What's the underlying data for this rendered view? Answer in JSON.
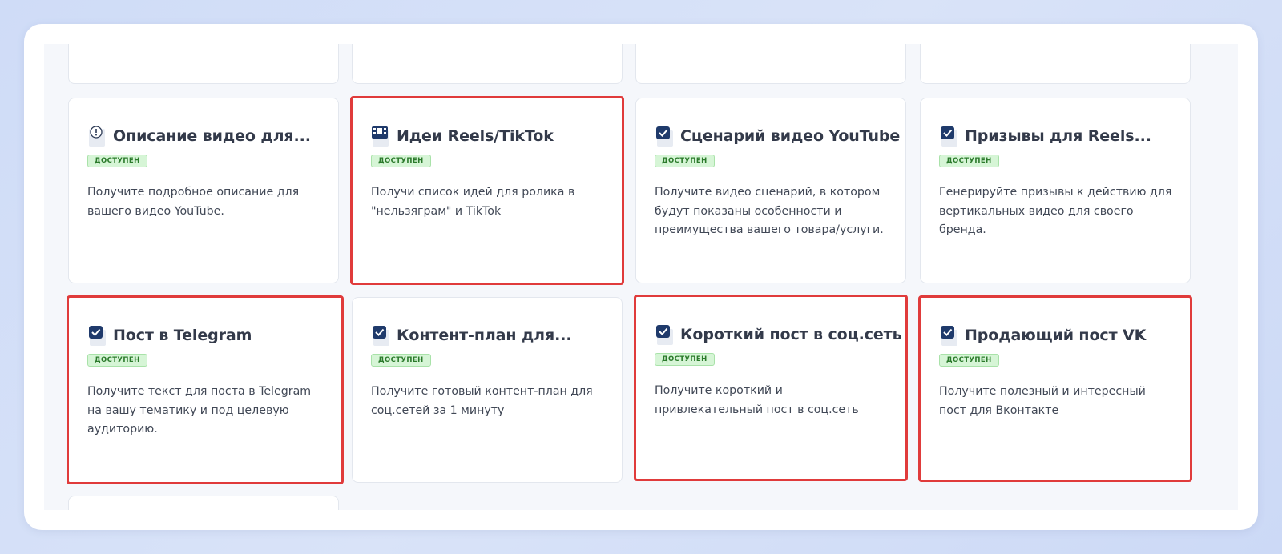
{
  "badge_label": "доступен",
  "colors": {
    "highlight": "#e03b3b",
    "badge_bg": "#d6f5d6",
    "badge_text": "#2b7a2b",
    "checkbox": "#1f3a6b"
  },
  "cards": [
    {
      "title": "Описание видео для...",
      "description": "Получите подробное описание для вашего видео YouTube.",
      "icon": "clock-info-icon"
    },
    {
      "title": "Идеи Reels/TikTok",
      "description": "Получи список идей для ролика в \"нельзяграм\" и TikTok",
      "icon": "film-icon"
    },
    {
      "title": "Сценарий видео YouTube",
      "description": "Получите видео сценарий, в котором будут показаны особенности и преимущества вашего товара/услуги.",
      "icon": "checkbox-icon"
    },
    {
      "title": "Призывы для Reels...",
      "description": "Генерируйте призывы к действию для вертикальных видео для своего бренда.",
      "icon": "checkbox-icon"
    },
    {
      "title": "Пост в Telegram",
      "description": "Получите текст для поста в Telegram на вашу тематику и под целевую аудиторию.",
      "icon": "checkbox-icon"
    },
    {
      "title": "Контент-план для...",
      "description": "Получите готовый контент-план для соц.сетей за 1 минуту",
      "icon": "checkbox-icon"
    },
    {
      "title": "Короткий пост в соц.сеть",
      "description": "Получите короткий и привлекательный пост в соц.сеть",
      "icon": "checkbox-icon"
    },
    {
      "title": "Продающий пост VK",
      "description": "Получите полезный и интересный пост для Вконтакте",
      "icon": "checkbox-icon"
    }
  ]
}
